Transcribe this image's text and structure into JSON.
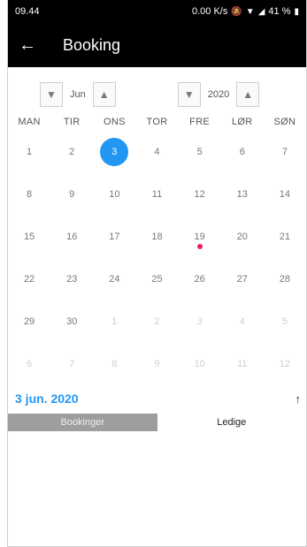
{
  "status": {
    "time": "09.44",
    "network": "0.00 K/s",
    "battery": "41 %"
  },
  "appbar": {
    "title": "Booking"
  },
  "selectors": {
    "month": "Jun",
    "year": "2020"
  },
  "weekdays": [
    "MAN",
    "TIR",
    "ONS",
    "TOR",
    "FRE",
    "LØR",
    "SØN"
  ],
  "weeks": [
    [
      "1",
      "2",
      "3",
      "4",
      "5",
      "6",
      "7"
    ],
    [
      "8",
      "9",
      "10",
      "11",
      "12",
      "13",
      "14"
    ],
    [
      "15",
      "16",
      "17",
      "18",
      "19",
      "20",
      "21"
    ],
    [
      "22",
      "23",
      "24",
      "25",
      "26",
      "27",
      "28"
    ],
    [
      "29",
      "30",
      "1",
      "2",
      "3",
      "4",
      "5"
    ],
    [
      "6",
      "7",
      "8",
      "9",
      "10",
      "11",
      "12"
    ]
  ],
  "selected_day": "3",
  "event_day": "19",
  "colors": {
    "accent": "#2196f3",
    "event_dot": "#e91e63"
  },
  "selected_date_label": "3 jun. 2020",
  "tabs": [
    {
      "label": "Bookinger",
      "active": true
    },
    {
      "label": "Ledige",
      "active": false
    }
  ]
}
